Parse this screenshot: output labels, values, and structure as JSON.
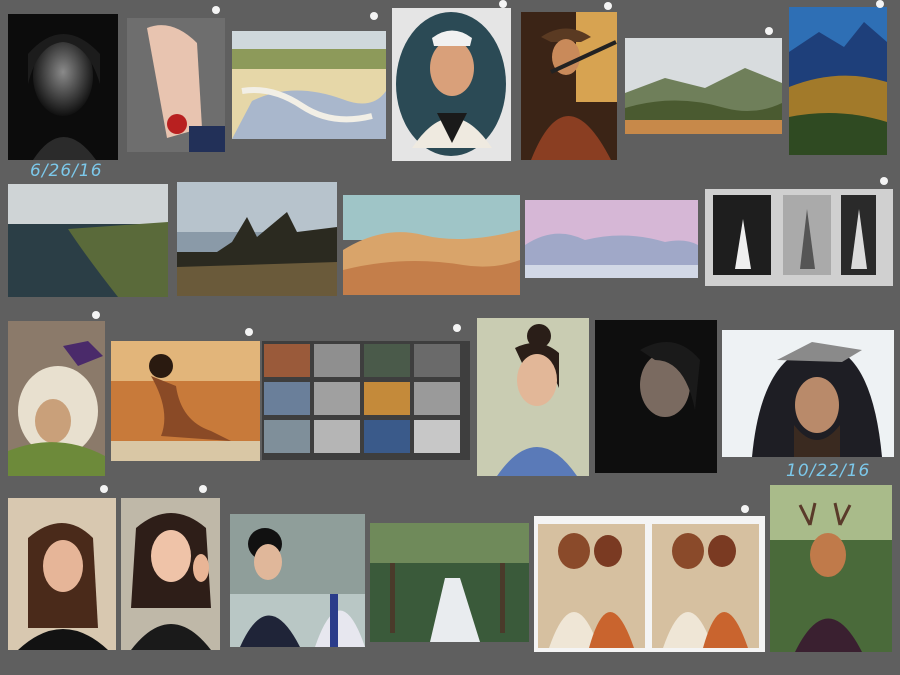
{
  "canvas": {
    "background": "#5f5f5f"
  },
  "date_labels": {
    "first": "6/26/16",
    "second": "10/22/16"
  },
  "pin_color": "#f4f4f4",
  "date_color": "#7cc8ea"
}
